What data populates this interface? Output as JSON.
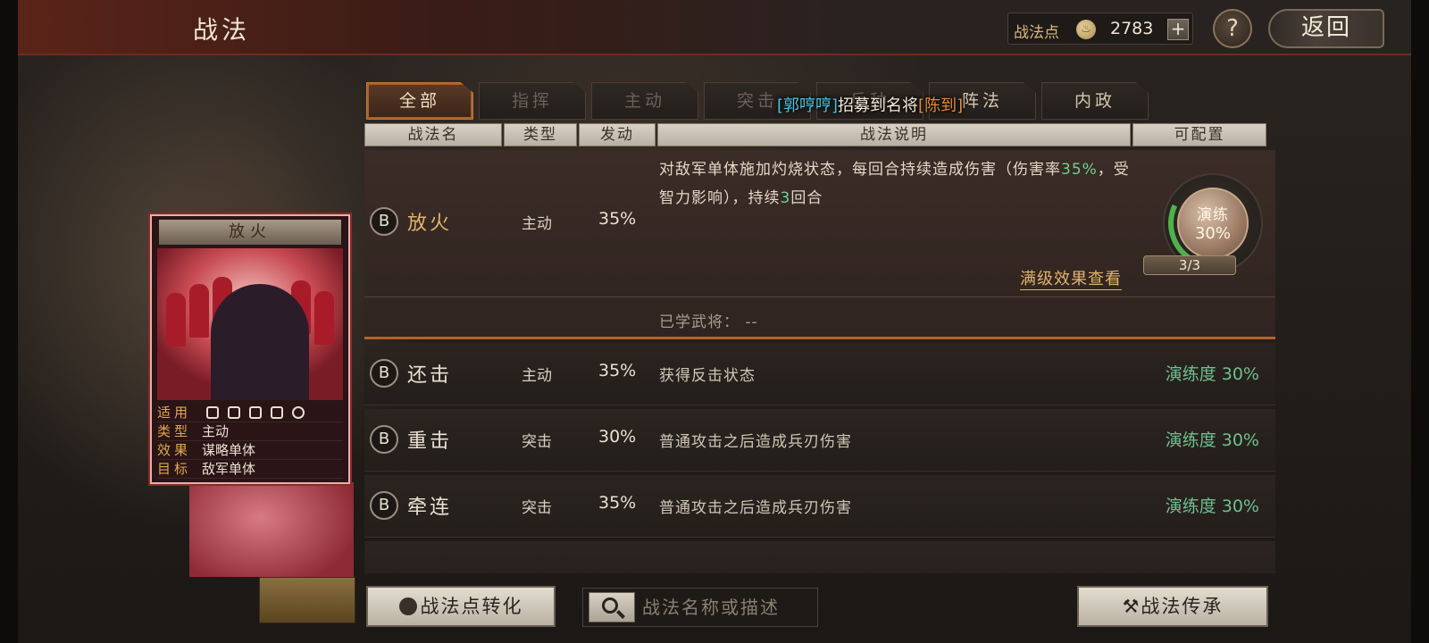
{
  "header": {
    "title": "战法",
    "points_label": "战法点",
    "points_value": "2783",
    "add_label": "+",
    "help_label": "?",
    "back_label": "返回"
  },
  "tabs": [
    {
      "label": "全部"
    },
    {
      "label": "指挥"
    },
    {
      "label": "主动"
    },
    {
      "label": "突击"
    },
    {
      "label": "兵种"
    },
    {
      "label": "阵法"
    },
    {
      "label": "内政"
    }
  ],
  "toast": {
    "prefix": "[郭哼哼]",
    "middle": "招募到名将",
    "suffix": "[陈到]"
  },
  "columns": {
    "name": "战法名",
    "type": "类型",
    "trigger": "发动",
    "desc": "战法说明",
    "assignable": "可配置"
  },
  "expanded": {
    "grade": "B",
    "name": "放火",
    "type": "主动",
    "rate": "35%",
    "desc_a": "对敌军单体施加灼烧状态，每回合持续造成伤害（伤害率",
    "desc_rate": "35%",
    "desc_b": "，受智力影响），持续",
    "desc_turns": "3",
    "desc_c": "回合",
    "medal_label": "演练",
    "medal_value": "30%",
    "medal_count": "3/3",
    "full_link": "满级效果查看",
    "learned": "已学武将：  --"
  },
  "rows": [
    {
      "grade": "B",
      "name": "还击",
      "type": "主动",
      "rate": "35%",
      "desc": "获得反击状态",
      "train": "演练度 30%"
    },
    {
      "grade": "B",
      "name": "重击",
      "type": "突击",
      "rate": "30%",
      "desc": "普通攻击之后造成兵刃伤害",
      "train": "演练度 30%"
    },
    {
      "grade": "B",
      "name": "牵连",
      "type": "突击",
      "rate": "35%",
      "desc": "普通攻击之后造成兵刃伤害",
      "train": "演练度 30%"
    }
  ],
  "card": {
    "title": "放火",
    "rows": [
      {
        "key": "适用",
        "value": ""
      },
      {
        "key": "类型",
        "value": "主动"
      },
      {
        "key": "效果",
        "value": "谋略单体"
      },
      {
        "key": "目标",
        "value": "敌军单体"
      }
    ]
  },
  "bottom": {
    "convert_label": "战法点转化",
    "search_placeholder": "战法名称或描述",
    "inherit_label": "战法传承"
  },
  "colors": {
    "accent_orange": "#b3622c",
    "train_green": "#6fbf8e",
    "gold_text": "#e0b46a",
    "toast_cyan": "#49c6e8",
    "toast_orange": "#e68a3c"
  }
}
